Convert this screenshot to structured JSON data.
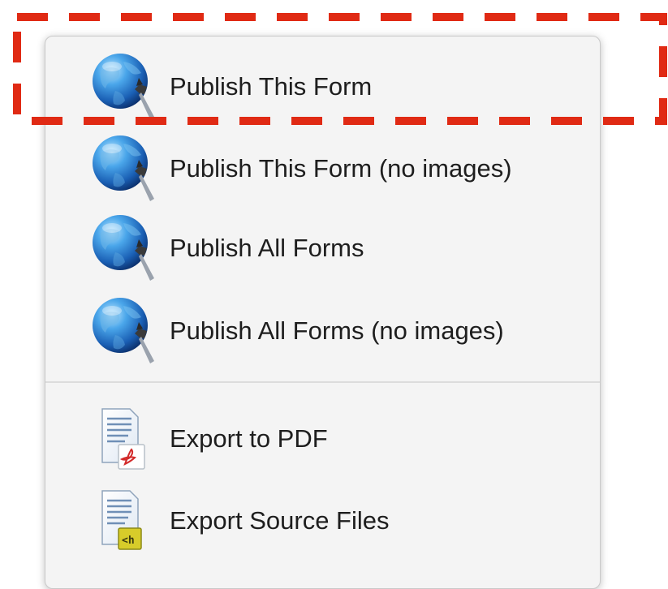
{
  "menu": {
    "items": [
      {
        "label": "Publish This Form",
        "icon": "globe-icon"
      },
      {
        "label": "Publish This Form (no images)",
        "icon": "globe-icon"
      },
      {
        "label": "Publish All Forms",
        "icon": "globe-icon"
      },
      {
        "label": "Publish All Forms (no images)",
        "icon": "globe-icon"
      },
      {
        "label": "Export to PDF",
        "icon": "pdf-document-icon"
      },
      {
        "label": "Export Source Files",
        "icon": "html-document-icon"
      }
    ]
  },
  "annotation": {
    "color": "#e02a14",
    "style": "dashed",
    "target": "Publish This Form"
  },
  "colors": {
    "menu_bg": "#f4f4f4",
    "text": "#1e1e1e",
    "globe": "#2f7fd0"
  }
}
